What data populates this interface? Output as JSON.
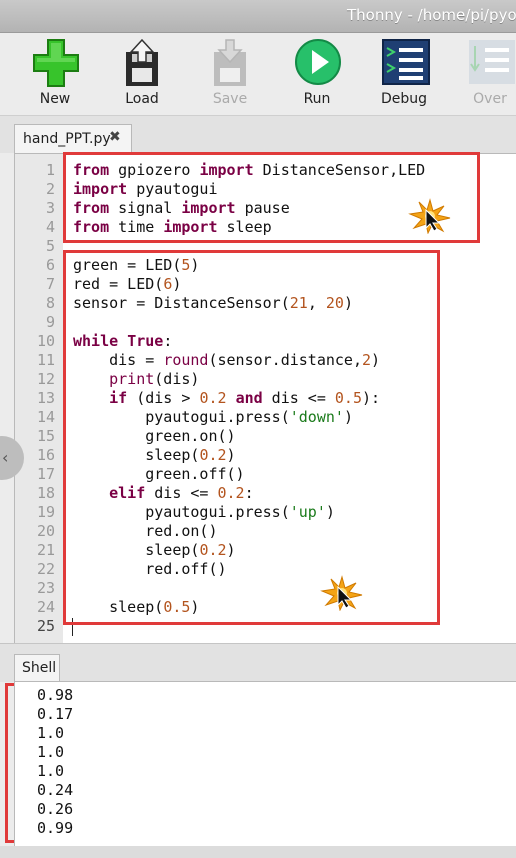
{
  "window": {
    "title": "Thonny  -  /home/pi/pyo"
  },
  "toolbar": [
    {
      "id": "new",
      "label": "New",
      "icon": "new-file-plus-icon",
      "enabled": true
    },
    {
      "id": "load",
      "label": "Load",
      "icon": "load-folder-icon",
      "enabled": true
    },
    {
      "id": "save",
      "label": "Save",
      "icon": "save-disk-icon",
      "enabled": false
    },
    {
      "id": "run",
      "label": "Run",
      "icon": "run-play-icon",
      "enabled": true
    },
    {
      "id": "debug",
      "label": "Debug",
      "icon": "debug-icon",
      "enabled": true
    },
    {
      "id": "over",
      "label": "Over",
      "icon": "step-over-icon",
      "enabled": false
    }
  ],
  "editor": {
    "tab_name": "hand_PPT.py",
    "tab_close": "✖",
    "line_numbers": [
      "1",
      "2",
      "3",
      "4",
      "5",
      "6",
      "7",
      "8",
      "9",
      "10",
      "11",
      "12",
      "13",
      "14",
      "15",
      "16",
      "17",
      "18",
      "19",
      "20",
      "21",
      "22",
      "23",
      "24",
      "25"
    ],
    "current_line": 25,
    "lines": [
      "from gpiozero import DistanceSensor,LED",
      "import pyautogui",
      "from signal import pause",
      "from time import sleep",
      "",
      "green = LED(5)",
      "red = LED(6)",
      "sensor = DistanceSensor(21, 20)",
      "",
      "while True:",
      "    dis = round(sensor.distance,2)",
      "    print(dis)",
      "    if (dis > 0.2 and dis <= 0.5):",
      "        pyautogui.press('down')",
      "        green.on()",
      "        sleep(0.2)",
      "        green.off()",
      "    elif dis <= 0.2:",
      "        pyautogui.press('up')",
      "        red.on()",
      "        sleep(0.2)",
      "        red.off()",
      "",
      "    sleep(0.5)",
      ""
    ]
  },
  "shell": {
    "tab_label": "Shell",
    "output": [
      "0.98",
      "0.17",
      "1.0",
      "1.0",
      "1.0",
      "0.24",
      "0.26",
      "0.99"
    ]
  },
  "colors": {
    "highlight_box": "#e03a3a",
    "keyword": "#7a0044",
    "number": "#b3541e",
    "string": "#1a7a1a"
  }
}
